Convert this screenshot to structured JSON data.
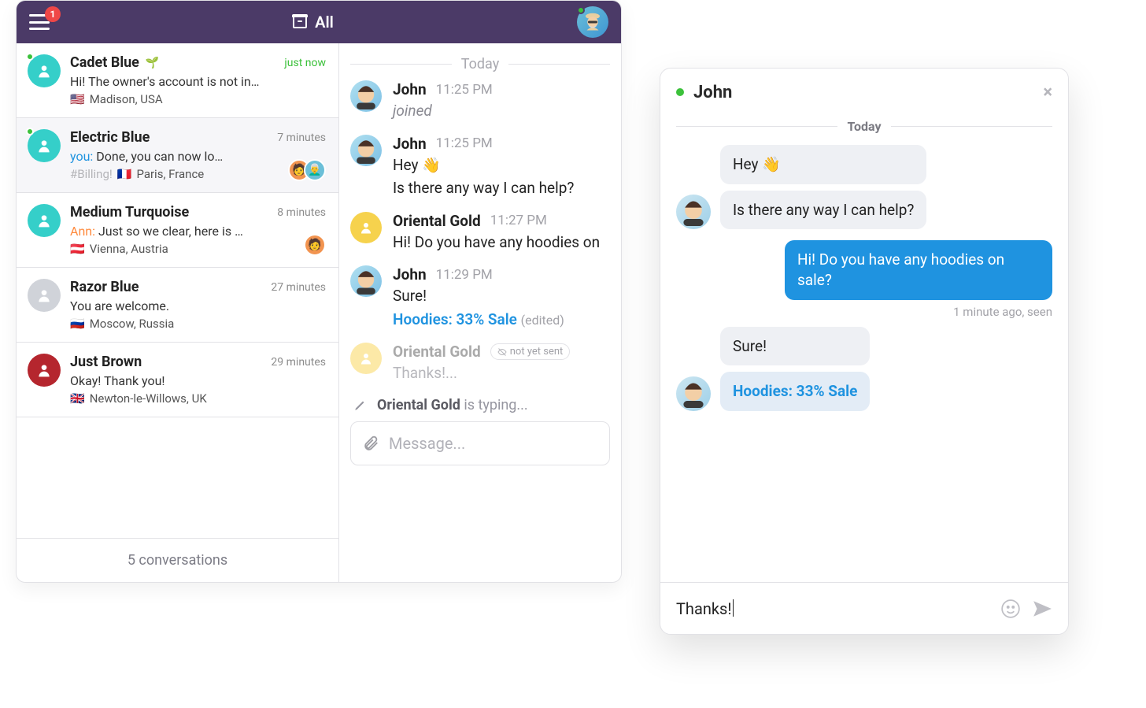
{
  "header": {
    "notification_count": "1",
    "tab_label": "All"
  },
  "conversations": {
    "footer_label": "5 conversations",
    "items": [
      {
        "name": "Cadet Blue",
        "time": "just now",
        "time_style": "green",
        "preview_prefix": "",
        "preview": "Hi! The owner's account is not in…",
        "tag": "",
        "location": "Madison, USA",
        "flag": "🇺🇸",
        "online": true,
        "avatar_color": "teal",
        "seedling": true,
        "active": false
      },
      {
        "name": "Electric Blue",
        "time": "7 minutes",
        "time_style": "",
        "preview_prefix": "you:",
        "preview": " Done, you can now lo…",
        "tag": "#Billing!",
        "location": "Paris, France",
        "flag": "🇫🇷",
        "online": true,
        "avatar_color": "teal",
        "seedling": false,
        "active": true
      },
      {
        "name": "Medium Turquoise",
        "time": "8 minutes",
        "time_style": "",
        "preview_prefix": "Ann:",
        "preview": " Just so we clear, here is …",
        "tag": "",
        "location": "Vienna, Austria",
        "flag": "🇦🇹",
        "online": false,
        "avatar_color": "teal",
        "seedling": false,
        "active": false
      },
      {
        "name": "Razor Blue",
        "time": "27 minutes",
        "time_style": "",
        "preview_prefix": "",
        "preview": "You are welcome.",
        "tag": "",
        "location": "Moscow, Russia",
        "flag": "🇷🇺",
        "online": false,
        "avatar_color": "grey",
        "seedling": false,
        "active": false
      },
      {
        "name": "Just Brown",
        "time": "29 minutes",
        "time_style": "",
        "preview_prefix": "",
        "preview": "Okay! Thank you!",
        "tag": "",
        "location": "Newton-le-Willows, UK",
        "flag": "🇬🇧",
        "online": false,
        "avatar_color": "red",
        "seedling": false,
        "active": false
      }
    ]
  },
  "chat": {
    "divider": "Today",
    "messages": [
      {
        "author": "John",
        "time": "11:25 PM",
        "avatar": "agent",
        "lines": [
          "joined"
        ],
        "italic": true
      },
      {
        "author": "John",
        "time": "11:25 PM",
        "avatar": "agent",
        "lines": [
          "Hey 👋",
          "Is there any way I can help?"
        ]
      },
      {
        "author": "Oriental Gold",
        "time": "11:27 PM",
        "avatar": "yellow",
        "lines": [
          "Hi! Do you have any hoodies on"
        ]
      },
      {
        "author": "John",
        "time": "11:29 PM",
        "avatar": "agent",
        "lines": [
          "Sure!"
        ],
        "link_line": "Hoodies: 33% Sale",
        "edited": "(edited)"
      },
      {
        "author": "Oriental Gold",
        "status": "not yet sent",
        "avatar": "yellow-faded",
        "lines": [
          "Thanks!..."
        ],
        "faded": true
      }
    ],
    "typing": {
      "name": "Oriental Gold",
      "suffix": "is typing..."
    },
    "compose_placeholder": "Message..."
  },
  "widget": {
    "title": "John",
    "divider": "Today",
    "incoming": [
      {
        "text": "Hey 👋",
        "style": "grey"
      },
      {
        "text": "Is there any way I can help?",
        "style": "grey"
      }
    ],
    "sent": {
      "text": "Hi! Do you have any hoodies on sale?",
      "meta": "1 minute ago, seen"
    },
    "incoming2": [
      {
        "text": "Sure!",
        "style": "grey"
      },
      {
        "text": "Hoodies: 33% Sale",
        "style": "link"
      }
    ],
    "input_value": "Thanks!"
  }
}
